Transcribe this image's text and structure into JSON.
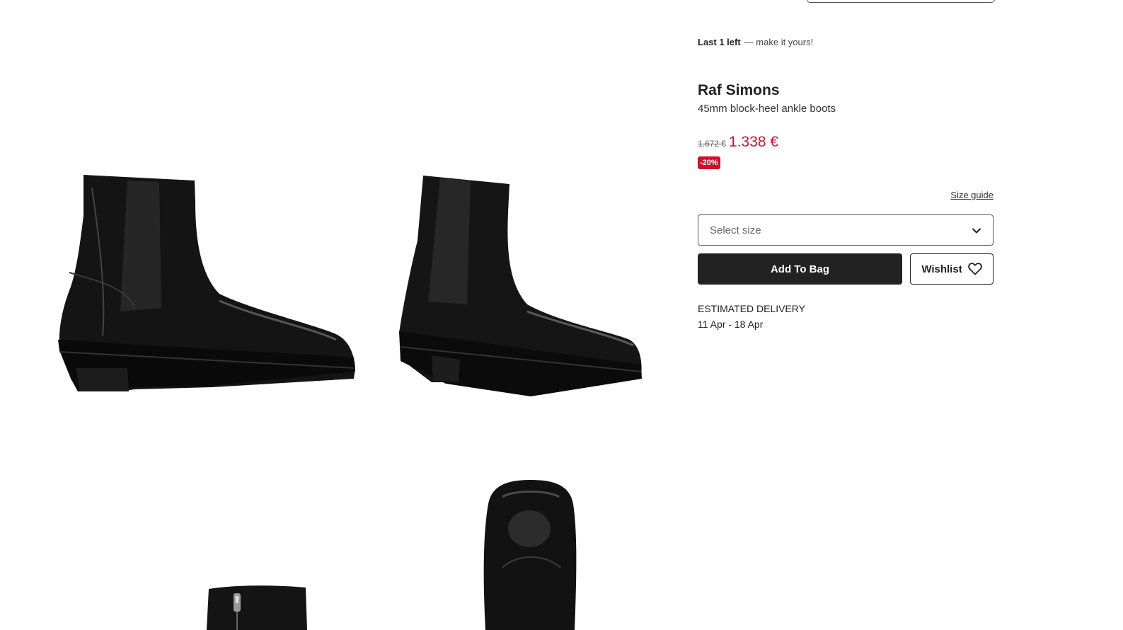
{
  "product": {
    "stock_bold": "Last 1 left",
    "stock_rest": "— make it yours!",
    "brand": "Raf Simons",
    "description": "45mm block-heel ankle boots",
    "original_price": "1.672 €",
    "sale_price": "1.338 €",
    "discount_badge": "-20%"
  },
  "size": {
    "guide_link": "Size guide",
    "placeholder": "Select size"
  },
  "actions": {
    "add_to_bag": "Add To Bag",
    "wishlist": "Wishlist"
  },
  "delivery": {
    "label": "ESTIMATED DELIVERY",
    "dates": "11 Apr - 18 Apr"
  },
  "gallery": {
    "images": [
      "boot-side-left-view",
      "boot-side-angle-view",
      "boot-inner-zip-view",
      "boot-top-down-view"
    ]
  },
  "colors": {
    "sale": "#d20f2c",
    "primary_button": "#222222",
    "text": "#222222"
  },
  "icons": [
    "chevron-down-icon",
    "heart-icon"
  ]
}
